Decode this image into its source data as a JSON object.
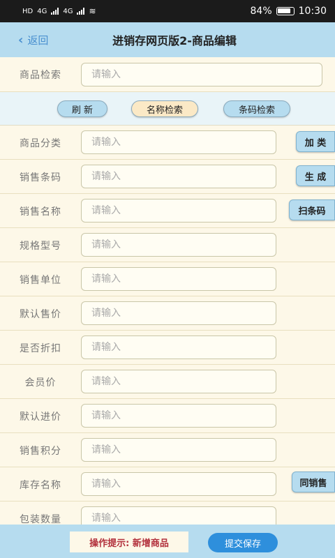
{
  "status": {
    "left": "HD",
    "net1": "4G",
    "net2": "4G",
    "battery": "84%",
    "time": "10:30"
  },
  "header": {
    "back_label": "返回",
    "title": "进销存网页版2-商品编辑"
  },
  "search": {
    "label": "商品检索",
    "placeholder": "请输入"
  },
  "search_actions": {
    "refresh": "刷 新",
    "name_search": "名称检索",
    "barcode_search": "条码检索"
  },
  "fields": [
    {
      "label": "商品分类",
      "placeholder": "请输入"
    },
    {
      "label": "销售条码",
      "placeholder": "请输入"
    },
    {
      "label": "销售名称",
      "placeholder": "请输入"
    },
    {
      "label": "规格型号",
      "placeholder": "请输入"
    },
    {
      "label": "销售单位",
      "placeholder": "请输入"
    },
    {
      "label": "默认售价",
      "placeholder": "请输入"
    },
    {
      "label": "是否折扣",
      "placeholder": "请输入"
    },
    {
      "label": "会员价",
      "placeholder": "请输入"
    },
    {
      "label": "默认进价",
      "placeholder": "请输入"
    },
    {
      "label": "销售积分",
      "placeholder": "请输入"
    },
    {
      "label": "库存名称",
      "placeholder": "请输入"
    },
    {
      "label": "包装数量",
      "placeholder": "请输入"
    }
  ],
  "side_buttons": {
    "add_category": "加 类",
    "generate": "生 成",
    "scan": "扫条码",
    "same_as_sales": "同销售"
  },
  "footer": {
    "tip": "操作提示: 新增商品",
    "submit": "提交保存"
  },
  "colors": {
    "background": "#fdf8e8",
    "accent_bar": "#b6dcef",
    "primary_button": "#2e8fdc",
    "tip_text": "#b2303c"
  }
}
